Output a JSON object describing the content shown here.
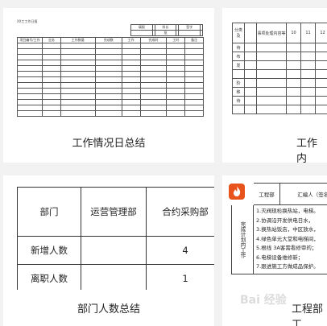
{
  "cards": [
    {
      "caption": "工作情况日总结"
    },
    {
      "caption": "工作内"
    },
    {
      "caption": "部门人数总结"
    },
    {
      "caption": "工程部工"
    }
  ],
  "thumb1": {
    "sheet_title": "XX工工作日报",
    "top_labels": [
      "填报",
      "科长",
      "批",
      "签字"
    ],
    "sub_label": "工作",
    "sub2": [
      "完成时",
      "工时"
    ],
    "headers": [
      "项目编号/工作",
      "业务",
      "工作数量",
      "完成数",
      "工作",
      "备注"
    ]
  },
  "thumb2": {
    "headers": [
      "分类及",
      "事项处理内容等",
      "10",
      "11",
      "12",
      "13"
    ],
    "row_labels": [
      "待",
      "布",
      "发",
      "阶",
      "移",
      "待"
    ]
  },
  "thumb3": {
    "headers": [
      "部门",
      "运营管理部",
      "合约采购部"
    ],
    "rows": [
      {
        "label": "新增人数",
        "values": [
          "",
          "4"
        ]
      },
      {
        "label": "离职人数",
        "values": [
          "",
          "1"
        ]
      }
    ]
  },
  "thumb4": {
    "header_left": "工程部",
    "header_right": "汇编人（签名）",
    "side_label": "完成计划内工作",
    "items": [
      "1.灭阀现检换热站，电梯。",
      "2.协调沿开发供电日水，",
      "3.换热站饭店，中区放水，",
      "4.绿色单元大堂和电梯间，",
      "5.根线 3A客需看修审的；",
      "6.电梯设备维修新；",
      "7.跟进施工方做成品保护。"
    ]
  },
  "watermark": "Bai 经验"
}
